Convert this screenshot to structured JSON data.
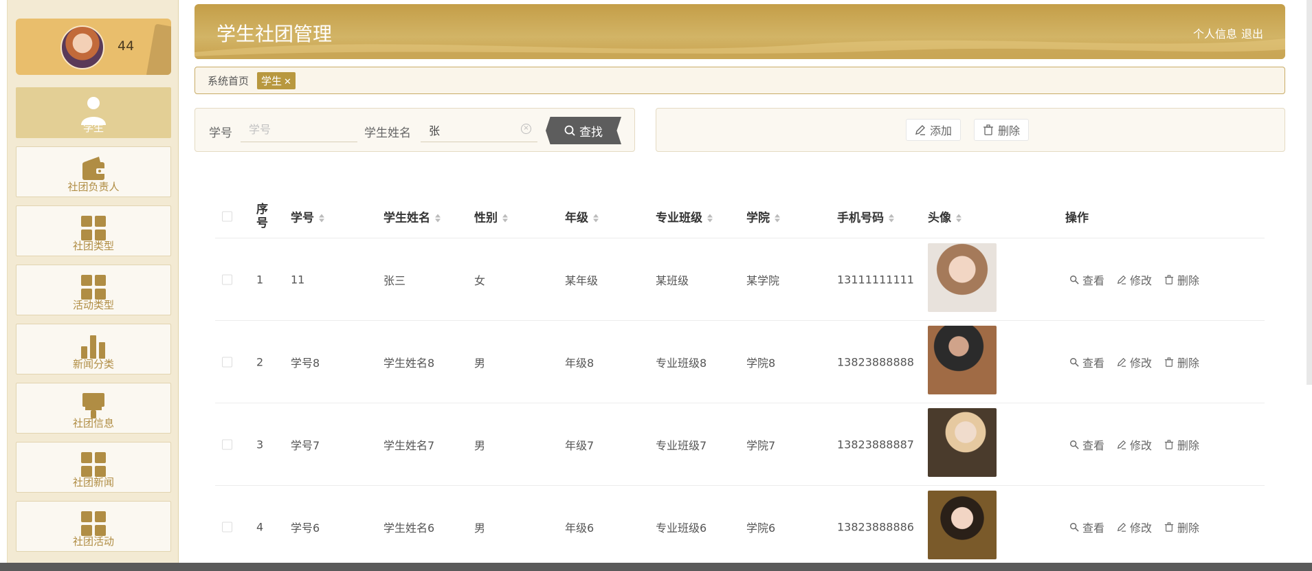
{
  "app": {
    "title": "学生社团管理",
    "header_links": [
      "个人信息",
      "退出"
    ]
  },
  "user": {
    "name": "44"
  },
  "sidebar": {
    "items": [
      {
        "label": "学生",
        "icon": "person-icon",
        "active": true
      },
      {
        "label": "社团负责人",
        "icon": "wallet-icon"
      },
      {
        "label": "社团类型",
        "icon": "grid-icon"
      },
      {
        "label": "活动类型",
        "icon": "grid-icon"
      },
      {
        "label": "新闻分类",
        "icon": "bar-chart-icon"
      },
      {
        "label": "社团信息",
        "icon": "brush-icon"
      },
      {
        "label": "社团新闻",
        "icon": "grid-icon"
      },
      {
        "label": "社团活动",
        "icon": "grid-icon"
      }
    ]
  },
  "breadcrumb": {
    "home": "系统首页",
    "current_tag": "学生",
    "close_glyph": "✕"
  },
  "search": {
    "id_label": "学号",
    "id_placeholder": "学号",
    "id_value": "",
    "name_label": "学生姓名",
    "name_value": "张",
    "button_label": "查找"
  },
  "actions": {
    "add_label": "添加",
    "delete_label": "删除"
  },
  "table": {
    "columns": [
      "序号",
      "学号",
      "学生姓名",
      "性别",
      "年级",
      "专业班级",
      "学院",
      "手机号码",
      "头像",
      "操作"
    ],
    "seq_header_lines": [
      "序",
      "号"
    ],
    "rows": [
      {
        "seq": "1",
        "id": "11",
        "name": "张三",
        "gender": "女",
        "grade": "某年级",
        "class": "某班级",
        "college": "某学院",
        "phone": "13111111111",
        "avatar": "photo-woman-bob"
      },
      {
        "seq": "2",
        "id": "学号8",
        "name": "学生姓名8",
        "gender": "男",
        "grade": "年级8",
        "class": "专业班级8",
        "college": "学院8",
        "phone": "13823888888",
        "avatar": "photo-man-selfie"
      },
      {
        "seq": "3",
        "id": "学号7",
        "name": "学生姓名7",
        "gender": "男",
        "grade": "年级7",
        "class": "专业班级7",
        "college": "学院7",
        "phone": "13823888887",
        "avatar": "photo-woman-dog"
      },
      {
        "seq": "4",
        "id": "学号6",
        "name": "学生姓名6",
        "gender": "男",
        "grade": "年级6",
        "class": "专业班级6",
        "college": "学院6",
        "phone": "13823888886",
        "avatar": "photo-man-portrait"
      }
    ],
    "row_ops": [
      "查看",
      "修改",
      "删除"
    ]
  },
  "colors": {
    "accent": "#c9a24e",
    "sidebar_bg": "#f3ead3",
    "active_menu": "#e3cf95",
    "search_button": "#5d5d5d"
  }
}
